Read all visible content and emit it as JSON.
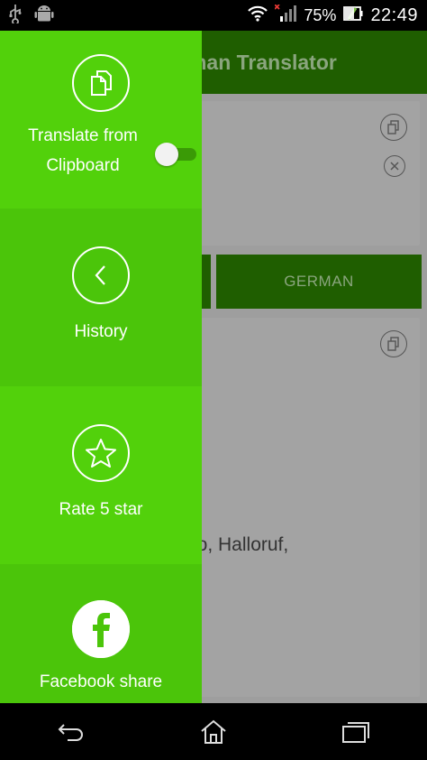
{
  "status_bar": {
    "battery": "75%",
    "time": "22:49"
  },
  "app": {
    "title": "rman Translator",
    "lang_right": "GERMAN",
    "translation_partial": "lo, Halloruf,"
  },
  "drawer": {
    "items": [
      {
        "label": "Translate from Clipboard",
        "icon": "clipboard-icon"
      },
      {
        "label": "History",
        "icon": "chevron-left-icon"
      },
      {
        "label": "Rate 5 star",
        "icon": "star-icon"
      },
      {
        "label": "Facebook share",
        "icon": "facebook-icon"
      }
    ],
    "toggle_on": false
  },
  "colors": {
    "drawer_green": "#52d10b",
    "drawer_green_alt": "#4bc50a",
    "app_bar": "#1f5e00",
    "scrim_gray": "#9e9e9e"
  }
}
